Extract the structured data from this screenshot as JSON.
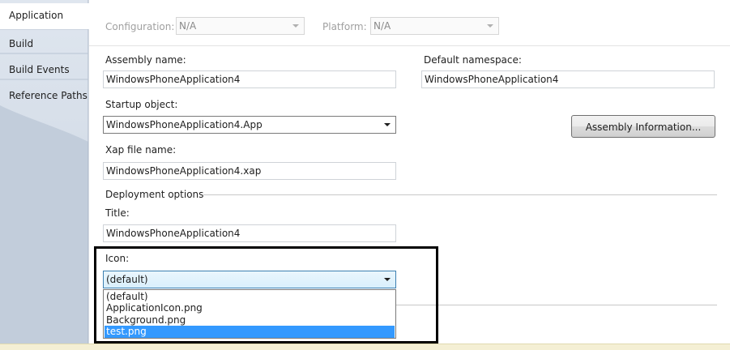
{
  "tabs": [
    {
      "label": "Application",
      "active": true
    },
    {
      "label": "Build",
      "active": false
    },
    {
      "label": "Build Events",
      "active": false
    },
    {
      "label": "Reference Paths",
      "active": false
    }
  ],
  "toolbar": {
    "configuration_label": "Configuration:",
    "configuration_value": "N/A",
    "platform_label": "Platform:",
    "platform_value": "N/A"
  },
  "form": {
    "assembly_name_label": "Assembly name:",
    "assembly_name_value": "WindowsPhoneApplication4",
    "default_namespace_label": "Default namespace:",
    "default_namespace_value": "WindowsPhoneApplication4",
    "startup_object_label": "Startup object:",
    "startup_object_value": "WindowsPhoneApplication4.App",
    "assembly_info_button": "Assembly Information...",
    "xap_file_label": "Xap file name:",
    "xap_file_value": "WindowsPhoneApplication4.xap",
    "deployment_options_label": "Deployment options",
    "title_label": "Title:",
    "title_value": "WindowsPhoneApplication4",
    "icon_label": "Icon:",
    "icon_value": "(default)",
    "icon_options": [
      "(default)",
      "ApplicationIcon.png",
      "Background.png",
      "test.png"
    ],
    "icon_selected_option": "test.png"
  },
  "colors": {
    "tab_strip": "#d5dde8",
    "selection": "#3399ff",
    "annotation_border": "#000000"
  }
}
